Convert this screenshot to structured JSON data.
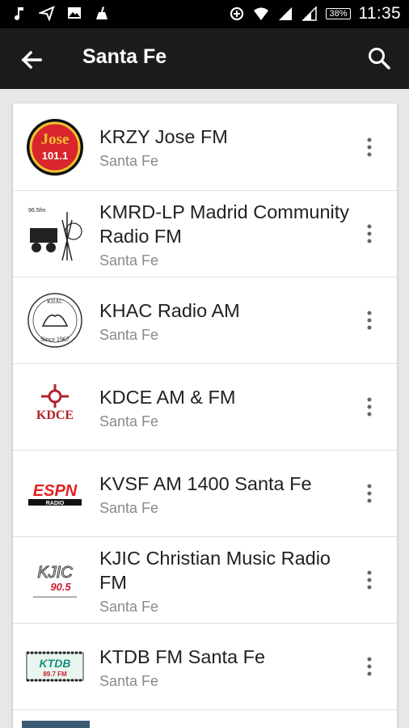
{
  "status_bar": {
    "time": "11:35",
    "battery": "38%",
    "icons": [
      "music-note-icon",
      "send-icon",
      "image-icon",
      "cleaner-icon",
      "data-saver-icon",
      "wifi-icon",
      "signal-icon",
      "signal-icon-2",
      "battery-icon"
    ]
  },
  "toolbar": {
    "title": "Santa Fe",
    "back_icon": "arrow-back-icon",
    "search_icon": "search-icon",
    "background": "#1c1c1c"
  },
  "stations": [
    {
      "name": "KRZY Jose FM",
      "location": "Santa Fe",
      "logo_icon": "jose-101-logo",
      "logo_text": "Jose 101.1"
    },
    {
      "name": "KMRD-LP Madrid Community Radio FM",
      "location": "Santa Fe",
      "logo_icon": "kmrd-logo"
    },
    {
      "name": "KHAC Radio AM",
      "location": "Santa Fe",
      "logo_icon": "khac-logo",
      "logo_text": "Since 1967"
    },
    {
      "name": "KDCE AM & FM",
      "location": "Santa Fe",
      "logo_icon": "kdce-logo",
      "logo_text": "KDCE"
    },
    {
      "name": "KVSF AM 1400 Santa Fe",
      "location": "Santa Fe",
      "logo_icon": "espn-radio-logo",
      "logo_text": "ESPN RADIO"
    },
    {
      "name": "KJIC Christian Music Radio FM",
      "location": "Santa Fe",
      "logo_icon": "kjic-logo",
      "logo_text": "KJIC 90.5"
    },
    {
      "name": "KTDB FM Santa Fe",
      "location": "Santa Fe",
      "logo_icon": "ktdb-logo",
      "logo_text": "KTDB 89.7 FM"
    }
  ],
  "more_icon": "more-vert-icon"
}
